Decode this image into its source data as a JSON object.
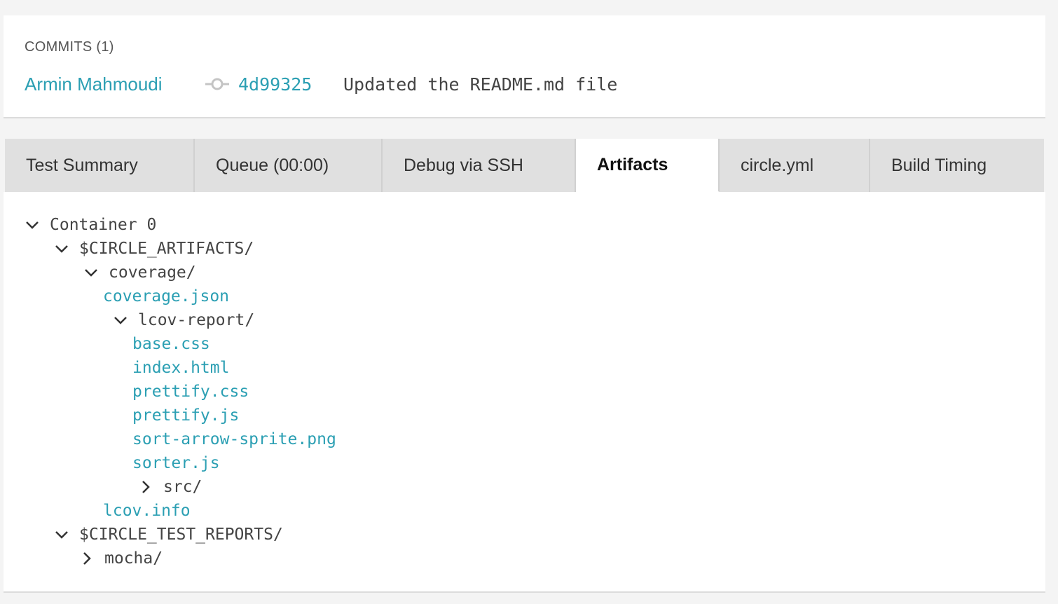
{
  "commits": {
    "title": "COMMITS (1)",
    "author": "Armin Mahmoudi",
    "sha": "4d99325",
    "message": "Updated the README.md file"
  },
  "tabs": [
    {
      "label": "Test Summary"
    },
    {
      "label": "Queue (00:00)"
    },
    {
      "label": "Debug via SSH"
    },
    {
      "label": "Artifacts"
    },
    {
      "label": "circle.yml"
    },
    {
      "label": "Build Timing"
    }
  ],
  "active_tab": "Artifacts",
  "tree": {
    "container": "Container 0",
    "circle_artifacts": "$CIRCLE_ARTIFACTS/",
    "coverage": "coverage/",
    "coverage_json": "coverage.json",
    "lcov_report": "lcov-report/",
    "base_css": "base.css",
    "index_html": "index.html",
    "prettify_css": "prettify.css",
    "prettify_js": "prettify.js",
    "sort_arrow": "sort-arrow-sprite.png",
    "sorter_js": "sorter.js",
    "src": "src/",
    "lcov_info": "lcov.info",
    "circle_test_reports": "$CIRCLE_TEST_REPORTS/",
    "mocha": "mocha/"
  },
  "colors": {
    "link": "#2b9fb3",
    "text": "#444444",
    "tab_bg": "#e0e0e0",
    "active_tab_bg": "#ffffff"
  },
  "icons": {
    "expanded": "chevron-down-icon",
    "collapsed": "chevron-right-icon",
    "commit": "git-commit-icon"
  }
}
